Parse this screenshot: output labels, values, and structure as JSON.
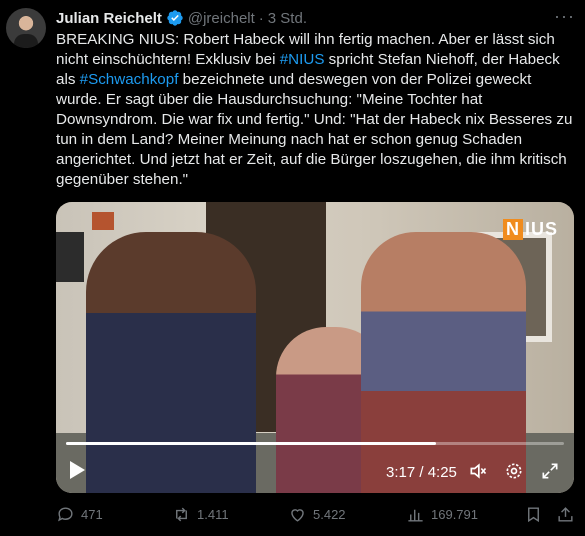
{
  "tweet": {
    "author_name": "Julian Reichelt",
    "handle": "@jreichelt",
    "separator": "·",
    "time": "3 Std.",
    "more": "···",
    "text_parts": [
      {
        "text": "BREAKING NIUS: Robert Habeck will ihn fertig machen. Aber er lässt sich nicht einschüchtern! Exklusiv bei ",
        "link": false
      },
      {
        "text": "#NIUS",
        "link": true
      },
      {
        "text": " spricht Stefan Niehoff, der Habeck als ",
        "link": false
      },
      {
        "text": "#Schwachkopf",
        "link": true
      },
      {
        "text": " bezeichnete und deswegen von der Polizei geweckt wurde. Er sagt über die Hausdurchsuchung: \"Meine Tochter hat Downsyndrom. Die war fix und fertig.\" Und: \"Hat der Habeck nix Besseres zu tun in dem Land? Meiner Meinung nach hat er schon genug Schaden angerichtet. Und jetzt hat er Zeit, auf die Bürger loszugehen, die ihm kritisch gegenüber stehen.\"",
        "link": false
      }
    ]
  },
  "video": {
    "logo_letter": "N",
    "logo_rest": "IUS",
    "current_time": "3:17",
    "duration": "4:25",
    "time_display": "3:17 / 4:25",
    "progress_fraction": 0.743
  },
  "actions": {
    "replies": "471",
    "reposts": "1.411",
    "likes": "5.422",
    "views": "169.791"
  },
  "colors": {
    "accent": "#1d9bf0",
    "muted": "#71767b",
    "background": "#000000",
    "logo_orange": "#f08c1e"
  },
  "icons": [
    "verified-badge-icon",
    "more-icon",
    "play-icon",
    "volume-icon",
    "settings-icon",
    "fullscreen-icon",
    "reply-icon",
    "repost-icon",
    "like-icon",
    "views-icon",
    "bookmark-icon",
    "share-icon"
  ]
}
